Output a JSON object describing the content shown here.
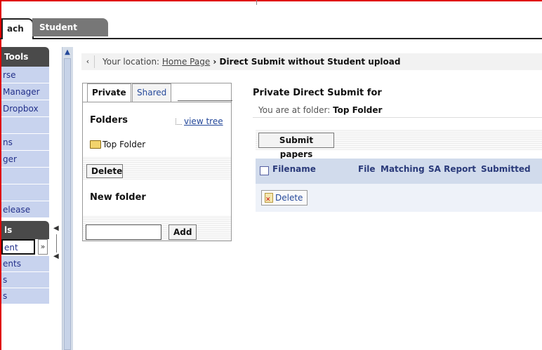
{
  "tabs": {
    "teach": "ach",
    "student_view": "Student View"
  },
  "left_nav": {
    "tools_heading": "Tools",
    "items": [
      "rse",
      "Manager",
      "Dropbox",
      "",
      "ns",
      "ger",
      "",
      "",
      "elease"
    ],
    "section2_heading": "ls",
    "select_value": "ent",
    "items2": [
      "ents",
      "s",
      "s"
    ]
  },
  "location": {
    "prefix": "Your location: ",
    "home": "Home Page",
    "separator": " › ",
    "current": "Direct Submit without Student upload"
  },
  "folders": {
    "tab_private": "Private",
    "tab_shared": "Shared",
    "title": "Folders",
    "view_tree": "view tree",
    "folder_name": "Top Folder",
    "delete_label": "Delete",
    "new_folder_title": "New folder",
    "new_folder_value": "",
    "add_label": "Add"
  },
  "main": {
    "title": "Private Direct Submit for",
    "subtitle_prefix": "You are at folder: ",
    "subtitle_folder": "Top Folder",
    "submit_label": "Submit papers",
    "columns": [
      "Filename",
      "File",
      "Matching",
      "SA Report",
      "Submitted"
    ],
    "delete_label": "Delete"
  },
  "colors": {
    "frame": "#e00000",
    "nav_bg": "#c8d3ee",
    "grid_header": "#d1dbec",
    "link": "#24489a"
  }
}
